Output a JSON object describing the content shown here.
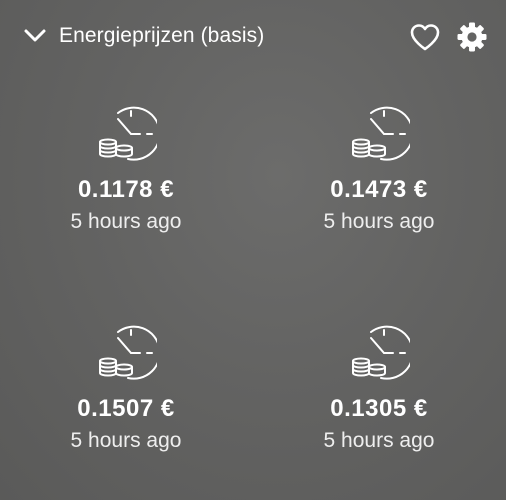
{
  "header": {
    "title": "Energieprijzen (basis)",
    "collapse_icon": "chevron-down-icon",
    "favorite_icon": "heart-outline-icon",
    "settings_icon": "gear-icon"
  },
  "tiles": [
    {
      "icon": "clock-coins-icon",
      "value": "0.1178 €",
      "time": "5 hours ago"
    },
    {
      "icon": "clock-coins-icon",
      "value": "0.1473 €",
      "time": "5 hours ago"
    },
    {
      "icon": "clock-coins-icon",
      "value": "0.1507 €",
      "time": "5 hours ago"
    },
    {
      "icon": "clock-coins-icon",
      "value": "0.1305 €",
      "time": "5 hours ago"
    }
  ],
  "colors": {
    "background": "#636362",
    "text": "#ffffff"
  }
}
